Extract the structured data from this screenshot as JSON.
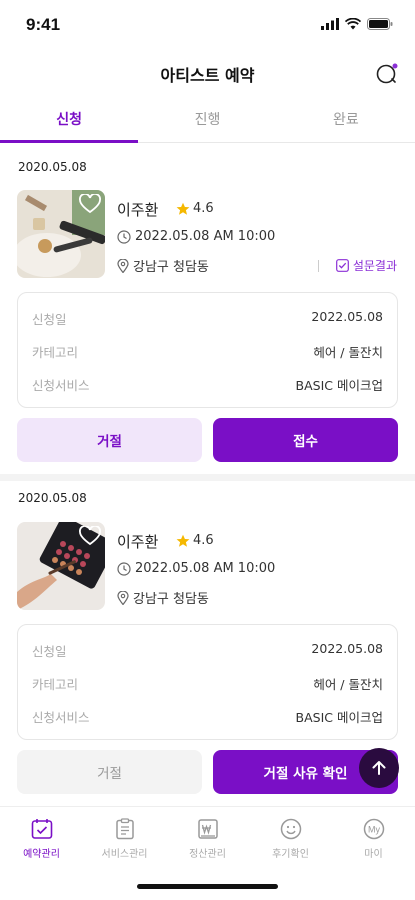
{
  "status": {
    "time": "9:41"
  },
  "header": {
    "title": "아티스트 예약"
  },
  "tabs": [
    {
      "label": "신청",
      "active": true
    },
    {
      "label": "진행",
      "active": false
    },
    {
      "label": "완료",
      "active": false
    }
  ],
  "requests": [
    {
      "date": "2020.05.08",
      "artist": "이주환",
      "rating": "4.6",
      "datetime": "2022.05.08 AM 10:00",
      "location": "강남구 청담동",
      "survey_label": "설문결과",
      "info": [
        {
          "key": "신청일",
          "value": "2022.05.08"
        },
        {
          "key": "카테고리",
          "value": "헤어 / 돌잔치"
        },
        {
          "key": "신청서비스",
          "value": "BASIC 메이크업"
        }
      ],
      "reject_label": "거절",
      "accept_label": "접수"
    },
    {
      "date": "2020.05.08",
      "artist": "이주환",
      "rating": "4.6",
      "datetime": "2022.05.08 AM 10:00",
      "location": "강남구 청담동",
      "info": [
        {
          "key": "신청일",
          "value": "2022.05.08"
        },
        {
          "key": "카테고리",
          "value": "헤어 / 돌잔치"
        },
        {
          "key": "신청서비스",
          "value": "BASIC 메이크업"
        }
      ],
      "reject_label": "거절",
      "accept_label": "거절 사유 확인"
    }
  ],
  "bottom_nav": [
    {
      "label": "예약관리",
      "icon": "calendar-check-icon",
      "active": true
    },
    {
      "label": "서비스관리",
      "icon": "clipboard-icon",
      "active": false
    },
    {
      "label": "정산관리",
      "icon": "won-receipt-icon",
      "active": false
    },
    {
      "label": "후기확인",
      "icon": "smile-icon",
      "active": false
    },
    {
      "label": "마이",
      "icon": "my-icon",
      "active": false
    }
  ],
  "colors": {
    "accent": "#7a0fc6",
    "accent_light": "#f1e6fa",
    "star": "#f5b800"
  }
}
